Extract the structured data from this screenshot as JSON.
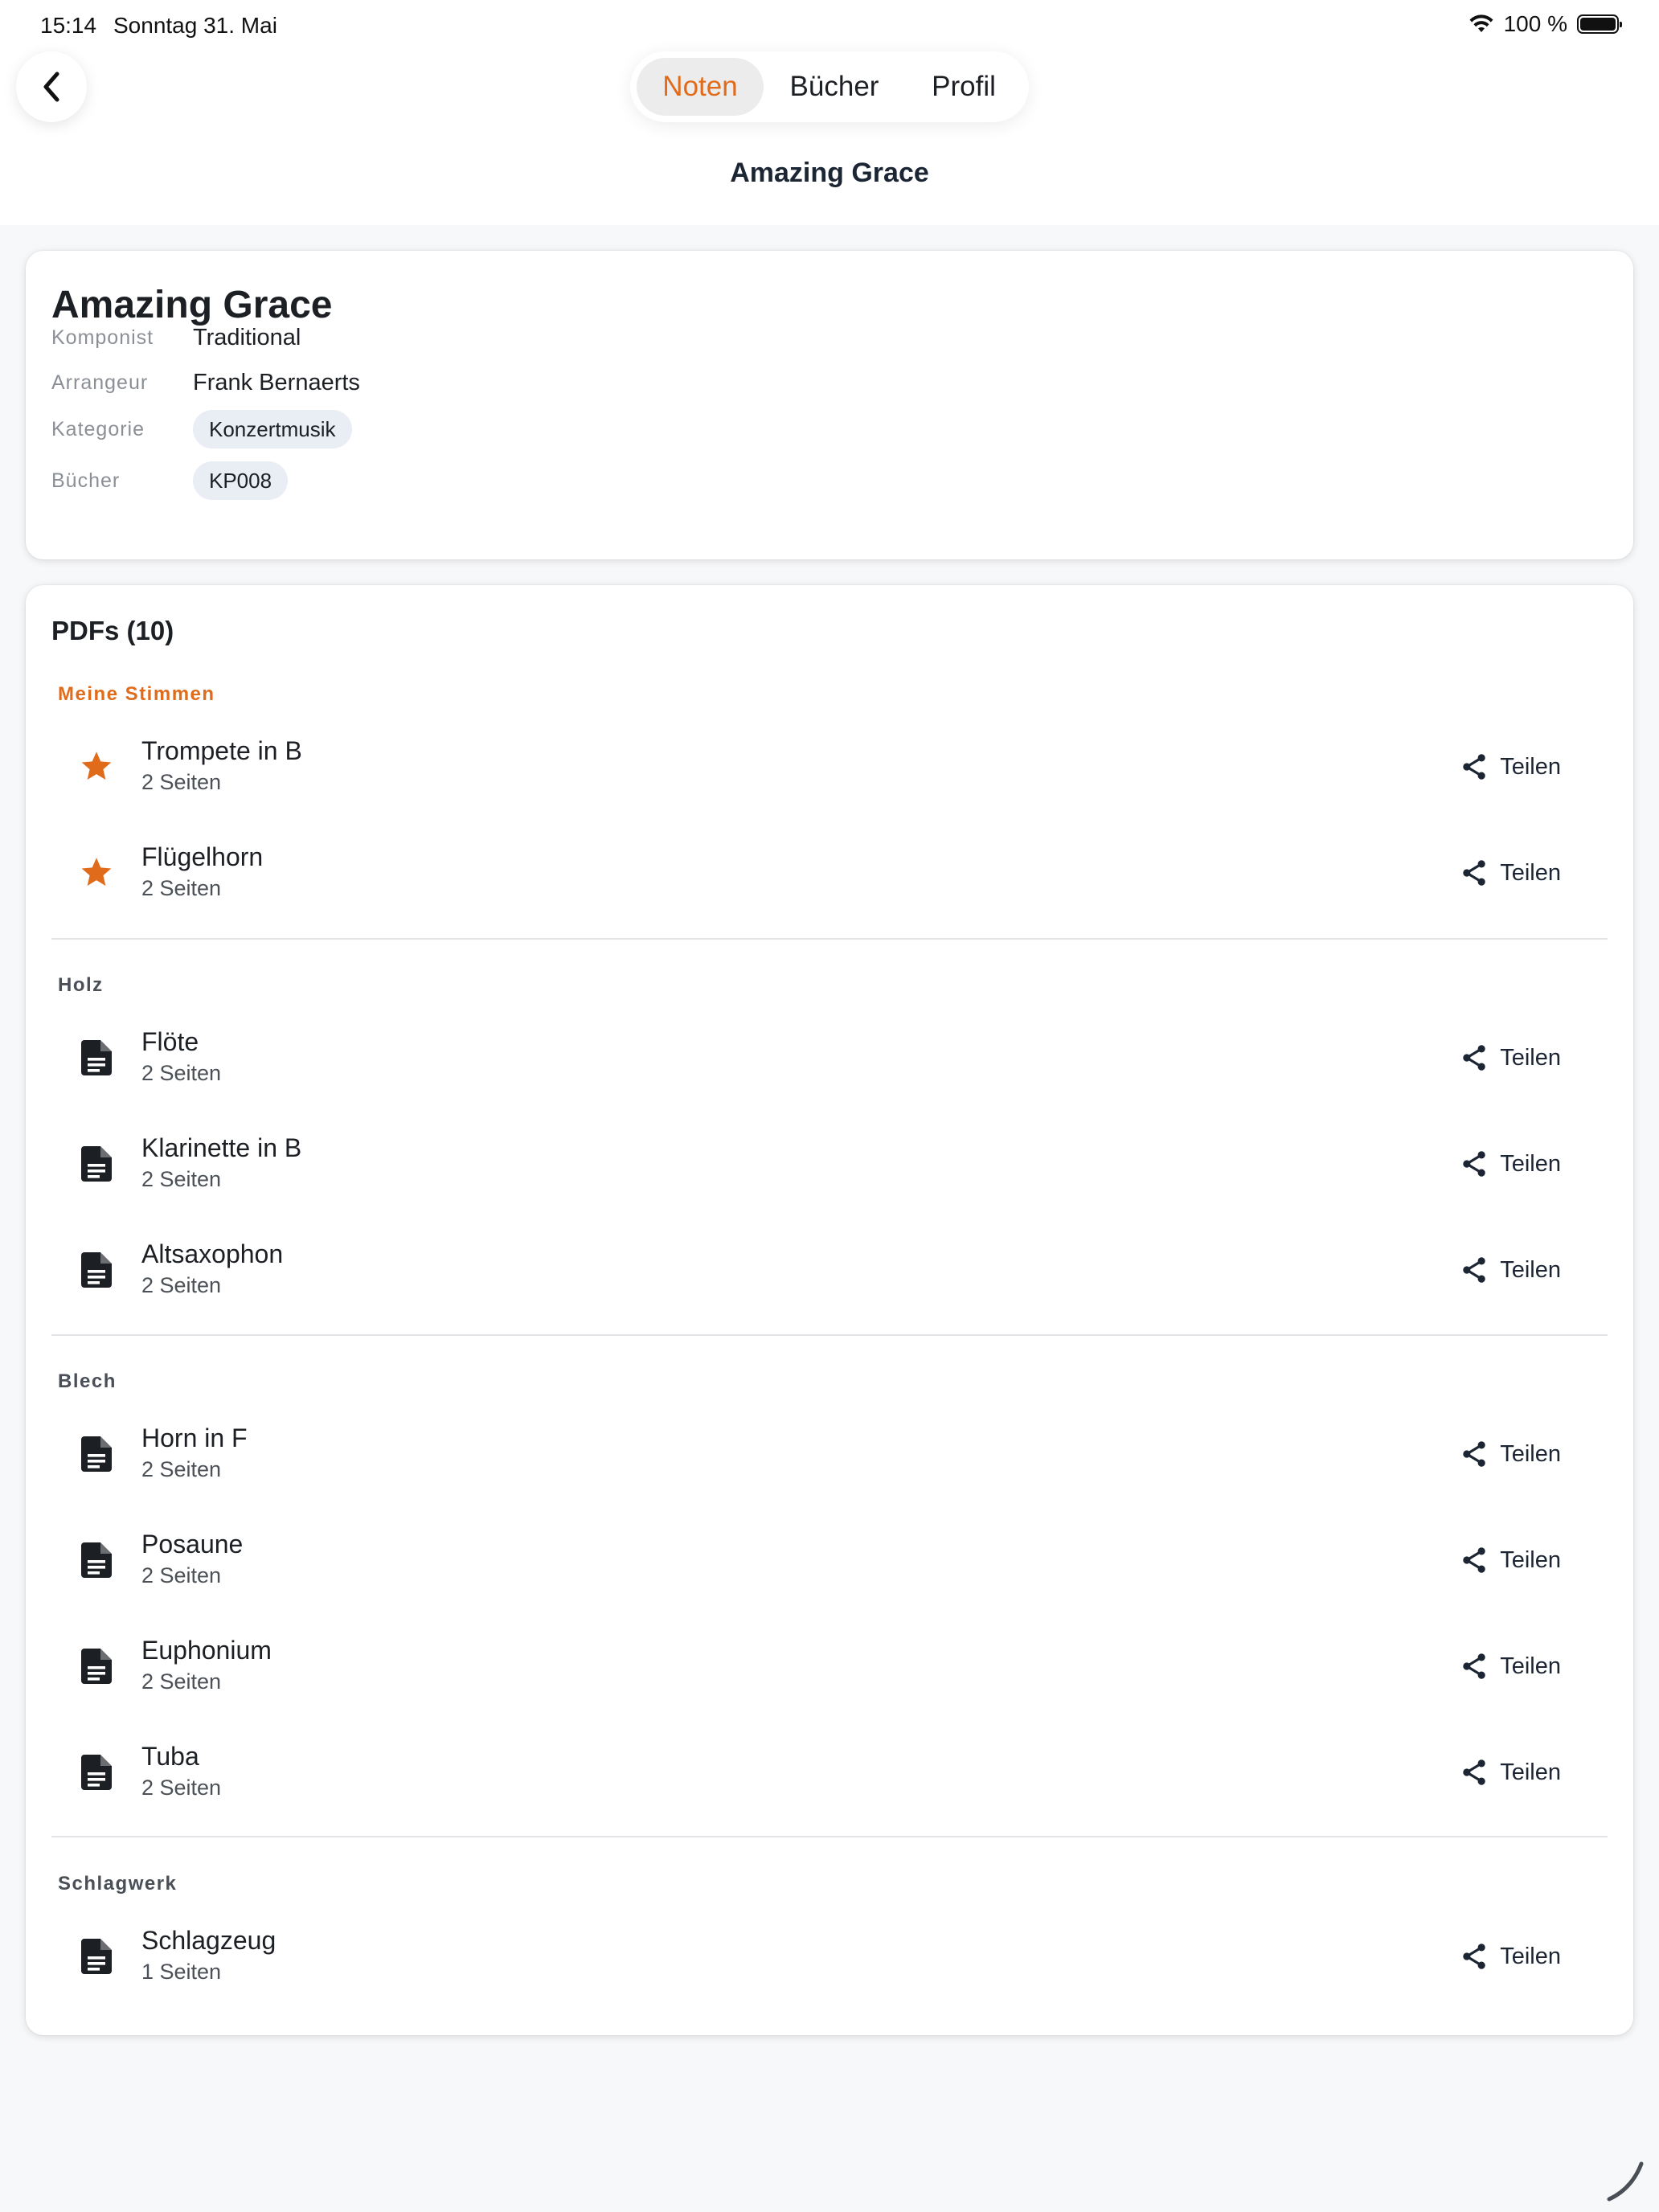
{
  "status_bar": {
    "time": "15:14",
    "date": "Sonntag 31. Mai",
    "battery": "100 %"
  },
  "nav": {
    "tabs": [
      {
        "label": "Noten",
        "active": true
      },
      {
        "label": "Bücher",
        "active": false
      },
      {
        "label": "Profil",
        "active": false
      }
    ],
    "title": "Amazing Grace"
  },
  "info": {
    "title": "Amazing Grace",
    "composer_label": "Komponist",
    "composer": "Traditional",
    "arranger_label": "Arrangeur",
    "arranger": "Frank Bernaerts",
    "category_label": "Kategorie",
    "category": "Konzertmusik",
    "books_label": "Bücher",
    "book": "KP008"
  },
  "pdfs": {
    "title": "PDFs (10)",
    "share_label": "Teilen",
    "sections": [
      {
        "title": "Meine Stimmen",
        "items": [
          {
            "name": "Trompete in B",
            "pages": "2 Seiten",
            "icon": "star-icon"
          },
          {
            "name": "Flügelhorn",
            "pages": "2 Seiten",
            "icon": "star-icon"
          }
        ]
      },
      {
        "title": "Holz",
        "items": [
          {
            "name": "Flöte",
            "pages": "2 Seiten",
            "icon": "document-icon"
          },
          {
            "name": "Klarinette in B",
            "pages": "2 Seiten",
            "icon": "document-icon"
          },
          {
            "name": "Altsaxophon",
            "pages": "2 Seiten",
            "icon": "document-icon"
          }
        ]
      },
      {
        "title": "Blech",
        "items": [
          {
            "name": "Horn in F",
            "pages": "2 Seiten",
            "icon": "document-icon"
          },
          {
            "name": "Posaune",
            "pages": "2 Seiten",
            "icon": "document-icon"
          },
          {
            "name": "Euphonium",
            "pages": "2 Seiten",
            "icon": "document-icon"
          },
          {
            "name": "Tuba",
            "pages": "2 Seiten",
            "icon": "document-icon"
          }
        ]
      },
      {
        "title": "Schlagwerk",
        "items": [
          {
            "name": "Schlagzeug",
            "pages": "1 Seiten",
            "icon": "document-icon"
          }
        ]
      }
    ]
  },
  "colors": {
    "accent": "#e06b1b",
    "text": "#1c1f24",
    "chip_bg": "#e9edf4",
    "background": "#f7f8fa"
  }
}
